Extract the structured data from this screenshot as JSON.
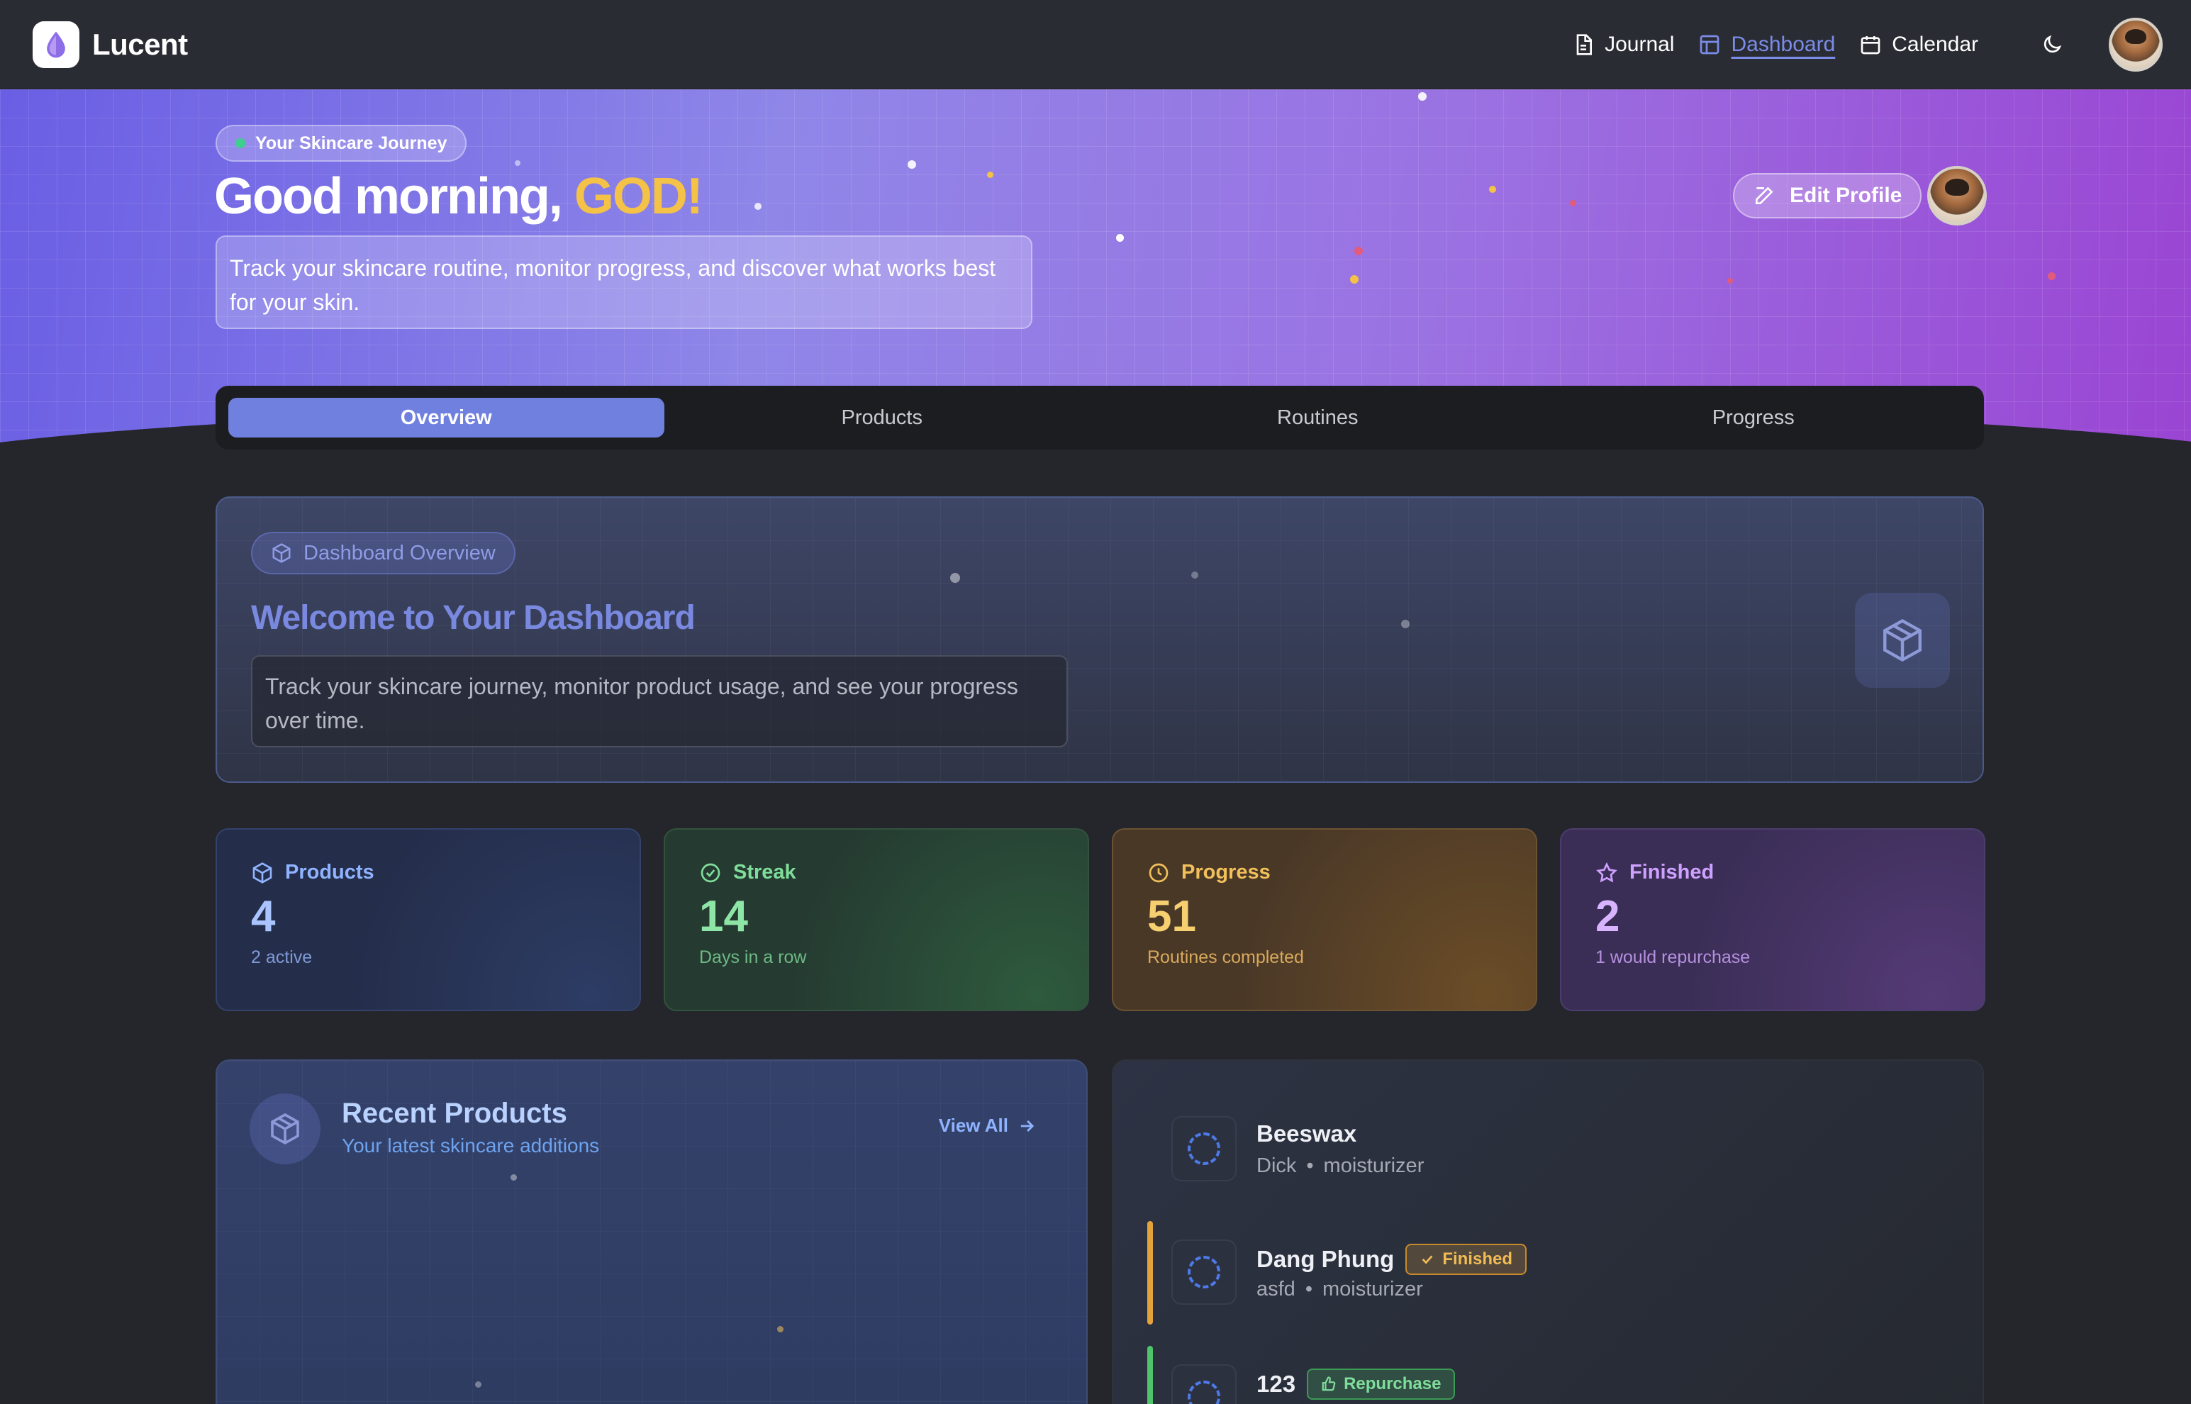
{
  "app": {
    "name": "Lucent",
    "brand_color": "#7b5ce0"
  },
  "nav": {
    "links": [
      {
        "label": "Journal",
        "icon": "document-icon",
        "active": false
      },
      {
        "label": "Dashboard",
        "icon": "layout-icon",
        "active": true
      },
      {
        "label": "Calendar",
        "icon": "calendar-icon",
        "active": false
      }
    ],
    "theme_icon": "moon-icon"
  },
  "hero": {
    "pill": "Your Skincare Journey",
    "greeting_prefix": "Good morning, ",
    "greeting_name": "GOD!",
    "description": "Track your skincare routine, monitor progress, and discover what works best for your skin.",
    "edit_profile": "Edit Profile"
  },
  "tabs": [
    {
      "label": "Overview",
      "active": true
    },
    {
      "label": "Products",
      "active": false
    },
    {
      "label": "Routines",
      "active": false
    },
    {
      "label": "Progress",
      "active": false
    }
  ],
  "welcome": {
    "pill": "Dashboard Overview",
    "title": "Welcome to Your Dashboard",
    "description": "Track your skincare journey, monitor product usage, and see your progress over time."
  },
  "stats": {
    "products": {
      "label": "Products",
      "value": "4",
      "sub": "2 active"
    },
    "streak": {
      "label": "Streak",
      "value": "14",
      "sub": "Days in a row"
    },
    "progress": {
      "label": "Progress",
      "value": "51",
      "sub": "Routines completed"
    },
    "finished": {
      "label": "Finished",
      "value": "2",
      "sub": "1 would repurchase"
    }
  },
  "recent": {
    "title": "Recent Products",
    "subtitle": "Your latest skincare additions",
    "view_all": "View All"
  },
  "products": [
    {
      "name": "Beeswax",
      "brand": "Dick",
      "type": "moisturizer",
      "badge": ""
    },
    {
      "name": "Dang Phung",
      "brand": "asfd",
      "type": "moisturizer",
      "badge": "Finished"
    },
    {
      "name": "123",
      "brand": "",
      "type": "",
      "badge": "Repurchase"
    }
  ],
  "meta_separator": "•"
}
